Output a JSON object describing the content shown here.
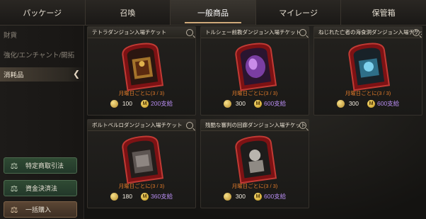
{
  "tabs": [
    {
      "label": "パッケージ"
    },
    {
      "label": "召喚"
    },
    {
      "label": "一般商品"
    },
    {
      "label": "マイレージ"
    },
    {
      "label": "保管箱"
    }
  ],
  "sidebar": {
    "items": [
      {
        "label": "財貨"
      },
      {
        "label": "強化/エンチャント/開拓"
      },
      {
        "label": "消耗品"
      }
    ],
    "buttons": [
      {
        "label": "特定商取引法"
      },
      {
        "label": "資金決済法"
      },
      {
        "label": "一括購入"
      }
    ]
  },
  "products": [
    {
      "title": "テトラダンジョン入場チケット",
      "cycle": "月曜日ごとに(3 / 3)",
      "cost": "100",
      "supply": "200支給",
      "art": "gold"
    },
    {
      "title": "トルシェー前教ダンジョン入場チケット",
      "cycle": "月曜日ごとに(3 / 3)",
      "cost": "300",
      "supply": "600支給",
      "art": "purple"
    },
    {
      "title": "ねじれた亡者の海食洞ダンジョン入場チケット",
      "cycle": "月曜日ごとに(3 / 3)",
      "cost": "300",
      "supply": "600支給",
      "art": "blue"
    },
    {
      "title": "ボルトベルロダンジョン入場チケット",
      "cycle": "月曜日ごとに(3 / 3)",
      "cost": "180",
      "supply": "360支給",
      "art": "grey"
    },
    {
      "title": "残酷な審判の回廊ダンジョン入場チケット",
      "cycle": "月曜日ごとに(3 / 3)",
      "cost": "300",
      "supply": "600支給",
      "art": "silver"
    }
  ],
  "currency_mark": "M",
  "colors": {
    "accent": "#cfa97a",
    "cycle": "#e07a2a",
    "supply": "#b78cf0",
    "ticket_frame": "#8e1518"
  }
}
